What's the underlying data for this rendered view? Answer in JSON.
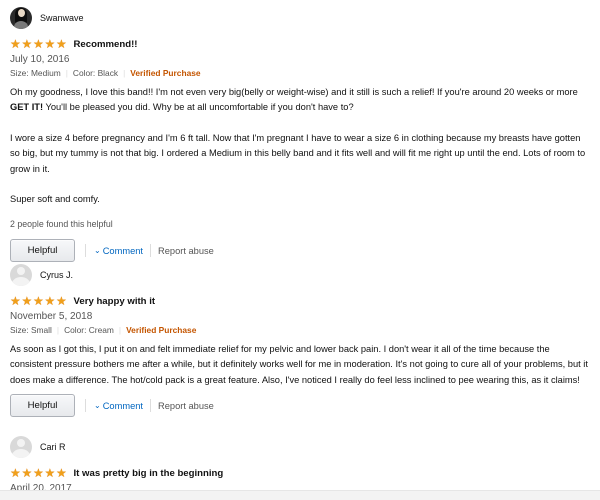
{
  "reviews": [
    {
      "reviewer": "Swanwave",
      "title": "Recommend!!",
      "rating": 5,
      "date": "July 10, 2016",
      "size": "Size: Medium",
      "color": "Color: Black",
      "verified": "Verified Purchase",
      "paragraph1_pre": "Oh my goodness, I love this band!! I'm not even very big(belly or weight-wise) and it still is such a relief! If you're around 20 weeks or more ",
      "paragraph1_bold": "GET IT!",
      "paragraph1_post": " You'll be pleased you did. Why be at all uncomfortable if you don't have to?",
      "paragraph2": "I wore a size 4 before pregnancy and I'm 6 ft tall. Now that I'm pregnant I have to wear a size 6 in clothing because my breasts have gotten so big, but my tummy is not that big. I ordered a Medium in this belly band and it fits well and will fit me right up until the end. Lots of room to grow in it.",
      "paragraph3": "Super soft and comfy.",
      "helpful_count": "2 people found this helpful",
      "helpful_label": "Helpful",
      "comment_label": "Comment",
      "report_label": "Report abuse"
    },
    {
      "reviewer": "Cyrus J.",
      "title": "Very happy with it",
      "rating": 5,
      "date": "November 5, 2018",
      "size": "Size: Small",
      "color": "Color: Cream",
      "verified": "Verified Purchase",
      "paragraph1": "As soon as I got this, I put it on and felt immediate relief for my pelvic and lower back pain. I don't wear it all of the time because the consistent pressure bothers me after a while, but it definitely works well for me in moderation. It's not going to cure all of your problems, but it does make a difference. The hot/cold pack is a great feature. Also, I've noticed I really do feel less inclined to pee wearing this, as it claims!",
      "helpful_label": "Helpful",
      "comment_label": "Comment",
      "report_label": "Report abuse"
    },
    {
      "reviewer": "Cari R",
      "title": "It was pretty big in the beginning",
      "rating": 5,
      "date": "April 20, 2017"
    }
  ],
  "colors": {
    "star": "#f0a01b",
    "verified": "#c45500",
    "link": "#0066c0",
    "muted": "#555555"
  },
  "icons": {
    "star": "★",
    "chevron": "⌄"
  }
}
